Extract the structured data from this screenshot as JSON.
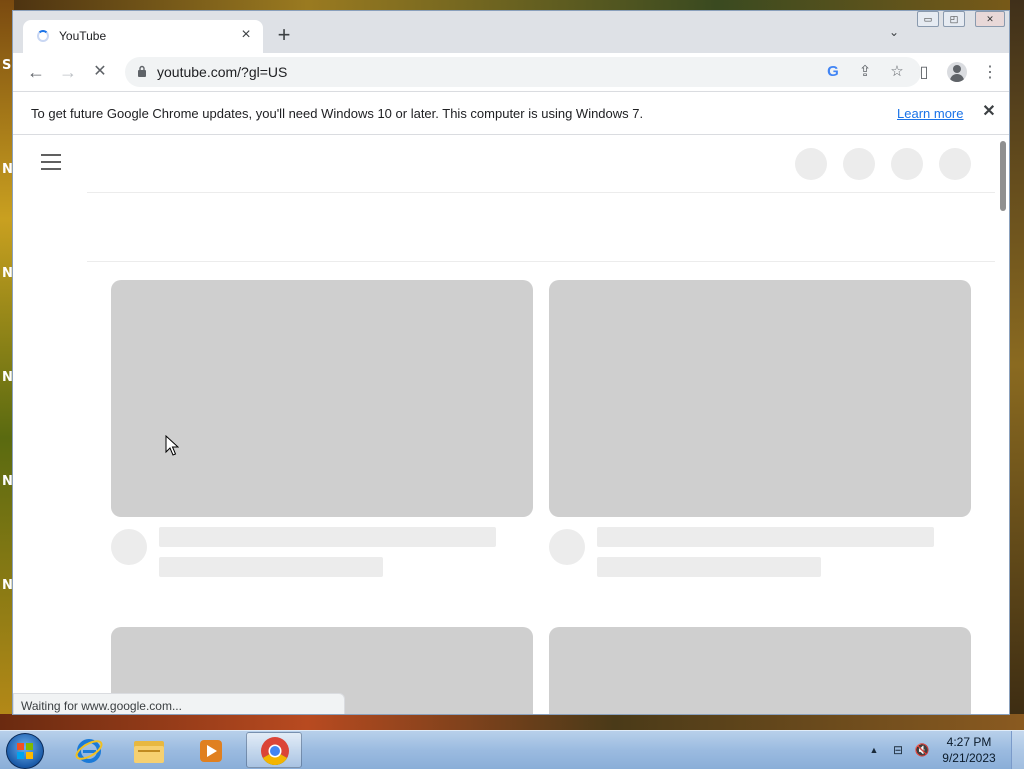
{
  "desktop": {
    "edge_letters": [
      "S",
      "N",
      "N",
      "N",
      "N",
      "N"
    ]
  },
  "browser": {
    "tab": {
      "title": "YouTube",
      "close_glyph": "×",
      "loading": true
    },
    "new_tab_glyph": "+",
    "tab_search_glyph": "⌄",
    "window_controls": {
      "minimize": "▭",
      "maximize": "◰",
      "close": "✕"
    },
    "toolbar": {
      "back_glyph": "←",
      "forward_glyph": "→",
      "stop_glyph": "✕",
      "url": "youtube.com/?gl=US",
      "google_glyph": "G",
      "share_glyph": "⇪",
      "bookmark_glyph": "☆",
      "side_panel_glyph": "▯",
      "menu_glyph": "⋮"
    },
    "infobar": {
      "message": "To get future Google Chrome updates, you'll need Windows 10 or later. This computer is using Windows 7.",
      "link": "Learn more",
      "close_glyph": "✕"
    },
    "status": "Waiting for www.google.com..."
  },
  "taskbar": {
    "clock_time": "4:27 PM",
    "clock_date": "9/21/2023",
    "tray_up_glyph": "▲",
    "tray_network_glyph": "⊟",
    "tray_volume_glyph": "🔇"
  },
  "colors": {
    "accent": "#1a73e8",
    "skeleton_thumb": "#cfcfcf",
    "skeleton_line": "#ececec"
  }
}
